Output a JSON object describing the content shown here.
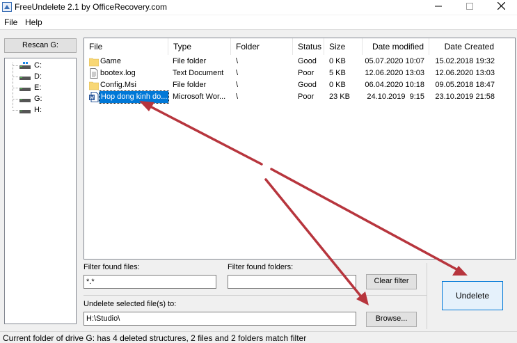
{
  "window": {
    "title": "FreeUndelete 2.1 by OfficeRecovery.com",
    "controls": [
      "minimize",
      "maximize",
      "close"
    ],
    "icon": "app-icon"
  },
  "menu": [
    "File",
    "Help"
  ],
  "rescan_label": "Rescan G:",
  "drives": [
    "C:",
    "D:",
    "E:",
    "G:",
    "H:"
  ],
  "list": {
    "columns": [
      "File",
      "Type",
      "Folder",
      "Status",
      "Size",
      "Date modified",
      "Date Created"
    ],
    "rows": [
      {
        "name": "Game",
        "type": "File folder",
        "folder": "\\",
        "status": "Good",
        "size": "0 KB",
        "modified": "05.07.2020 10:07",
        "created": "15.02.2018 19:32",
        "icon": "folder-icon"
      },
      {
        "name": "bootex.log",
        "type": "Text Document",
        "folder": "\\",
        "status": "Poor",
        "size": "5 KB",
        "modified": "12.06.2020 13:03",
        "created": "12.06.2020 13:03",
        "icon": "text-file-icon"
      },
      {
        "name": "Config.Msi",
        "type": "File folder",
        "folder": "\\",
        "status": "Good",
        "size": "0 KB",
        "modified": "06.04.2020 10:18",
        "created": "09.05.2018 18:47",
        "icon": "folder-icon"
      },
      {
        "name": "Hop dong kinh do...",
        "type": "Microsoft Wor...",
        "folder": "\\",
        "status": "Poor",
        "size": "23 KB",
        "modified": "24.10.2019  9:15",
        "created": "23.10.2019 21:58",
        "icon": "word-doc-icon",
        "selected": true
      }
    ]
  },
  "filter_files": {
    "label": "Filter found files:",
    "value": "*.*"
  },
  "filter_folders": {
    "label": "Filter found folders:",
    "value": ""
  },
  "clear_filter_label": "Clear filter",
  "undelete_to": {
    "label": "Undelete selected file(s) to:",
    "value": "H:\\Studio\\"
  },
  "browse_label": "Browse...",
  "undelete_label": "Undelete",
  "status": "Current folder of drive G: has 4 deleted structures, 2 files and 2 folders match filter",
  "colors": {
    "selection": "#0078d7",
    "arrow": "#b7353d",
    "folder": "#f8d775",
    "primary_border": "#0078d7"
  }
}
